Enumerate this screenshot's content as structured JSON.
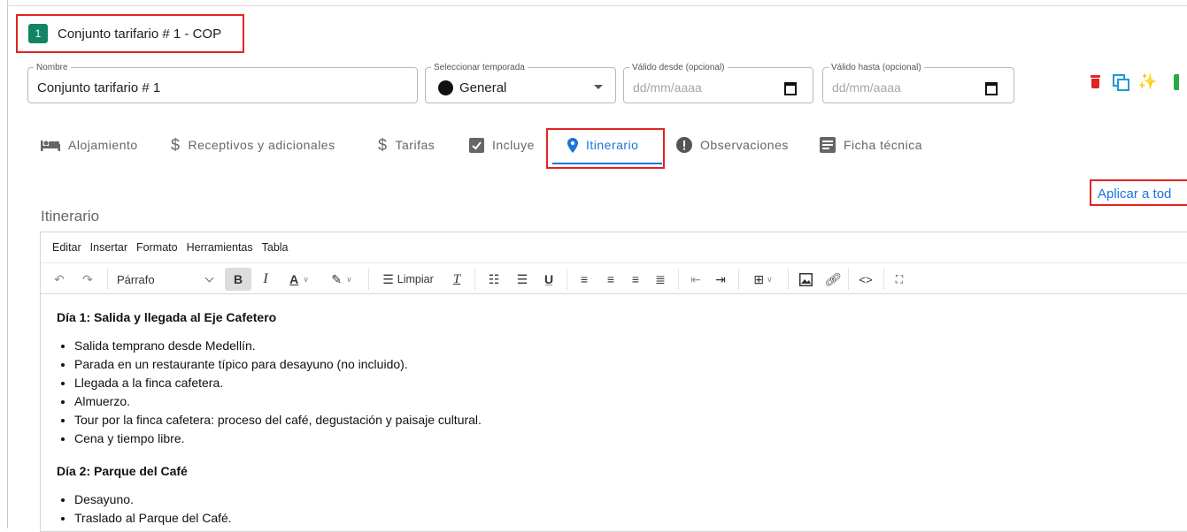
{
  "header": {
    "number": "1",
    "title": "Conjunto tarifario # 1 - COP"
  },
  "fields": {
    "nombre": {
      "label": "Nombre",
      "value": "Conjunto tarifario # 1"
    },
    "temporada": {
      "label": "Seleccionar temporada",
      "value": "General"
    },
    "desde": {
      "label": "Válido desde (opcional)",
      "placeholder": "dd/mm/aaaa"
    },
    "hasta": {
      "label": "Válido hasta (opcional)",
      "placeholder": "dd/mm/aaaa"
    }
  },
  "tabs": [
    {
      "label": "Alojamiento",
      "icon": "bed-icon"
    },
    {
      "label": "Receptivos y adicionales",
      "icon": "dollar-icon"
    },
    {
      "label": "Tarifas",
      "icon": "dollar-icon"
    },
    {
      "label": "Incluye",
      "icon": "checkbox-icon"
    },
    {
      "label": "Itinerario",
      "icon": "location-pin-icon",
      "active": true
    },
    {
      "label": "Observaciones",
      "icon": "exclamation-icon"
    },
    {
      "label": "Ficha técnica",
      "icon": "document-icon"
    }
  ],
  "apply_link": "Aplicar a tod",
  "section_label": "Itinerario",
  "editor": {
    "menu": [
      "Editar",
      "Insertar",
      "Formato",
      "Herramientas",
      "Tabla"
    ],
    "block_format": "Párrafo",
    "clear_label": "Limpiar",
    "day1": {
      "title": "Día 1: Salida y llegada al Eje Cafetero",
      "items": [
        "Salida temprano desde Medellín.",
        "Parada en un restaurante típico para desayuno (no incluido).",
        "Llegada a la finca cafetera.",
        "Almuerzo.",
        "Tour por la finca cafetera: proceso del café, degustación y paisaje cultural.",
        "Cena y tiempo libre."
      ]
    },
    "day2": {
      "title": "Día 2: Parque del Café",
      "items": [
        "Desayuno.",
        "Traslado al Parque del Café."
      ]
    }
  },
  "colors": {
    "accent": "#1a74d9",
    "danger": "#e02424",
    "brand": "#128465"
  }
}
